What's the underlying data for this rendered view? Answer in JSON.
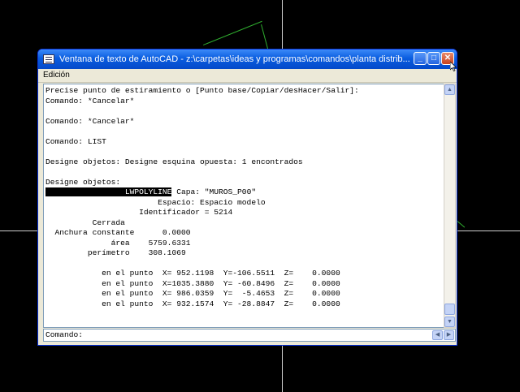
{
  "window": {
    "title": "Ventana de texto de AutoCAD - z:\\carpetas\\ideas y programas\\comandos\\planta distrib...",
    "minimize_glyph": "_",
    "maximize_glyph": "□",
    "close_glyph": "✕"
  },
  "menu": {
    "edit_label": "Edición"
  },
  "text_lines": [
    "Precise punto de estiramiento o [Punto base/Copiar/desHacer/Salir]:",
    "Comando: *Cancelar*",
    "",
    "Comando: *Cancelar*",
    "",
    "Comando: LIST",
    "",
    "Designe objetos: Designe esquina opuesta: 1 encontrados",
    "",
    "Designe objetos:",
    "",
    "                        Espacio: Espacio modelo",
    "                    Identificador = 5214",
    "          Cerrada",
    "  Anchura constante      0.0000",
    "              área    5759.6331",
    "         perímetro    308.1069",
    "",
    "            en el punto  X= 952.1198  Y=-106.5511  Z=    0.0000",
    "            en el punto  X=1035.3880  Y= -60.8496  Z=    0.0000",
    "            en el punto  X= 986.0359  Y=  -5.4653  Z=    0.0000",
    "            en el punto  X= 932.1574  Y= -28.8847  Z=    0.0000"
  ],
  "lwpolyline_row": {
    "highlight": "                 LWPOLYLINE",
    "rest": " Capa: \"MUROS_P00\""
  },
  "command_line": {
    "label": "Comando:"
  },
  "scroll": {
    "up": "▲",
    "down": "▼",
    "left": "◀",
    "right": "▶"
  }
}
